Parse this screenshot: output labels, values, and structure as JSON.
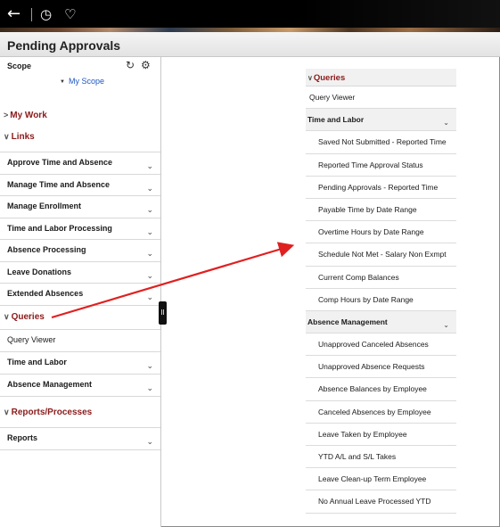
{
  "topbar": {
    "back_icon": "arrow-left-icon",
    "history_icon": "clock-icon",
    "favorites_icon": "heart-icon"
  },
  "page": {
    "title": "Pending Approvals"
  },
  "sidebar": {
    "scope": {
      "label": "Scope",
      "link": "My Scope",
      "refresh_icon": "refresh-icon",
      "settings_icon": "gear-icon"
    },
    "sections": {
      "my_work": "My Work",
      "links": "Links",
      "queries": "Queries",
      "reports": "Reports/Processes"
    },
    "links": [
      {
        "label": "Approve Time and Absence"
      },
      {
        "label": "Manage Time and Absence"
      },
      {
        "label": "Manage Enrollment"
      },
      {
        "label": "Time and Labor Processing"
      },
      {
        "label": "Absence Processing"
      },
      {
        "label": "Leave Donations"
      },
      {
        "label": "Extended Absences"
      }
    ],
    "queries": [
      {
        "label": "Query Viewer"
      },
      {
        "label": "Time and Labor"
      },
      {
        "label": "Absence Management"
      }
    ],
    "reports": [
      {
        "label": "Reports"
      }
    ]
  },
  "expanded_panel": {
    "header": "Queries",
    "query_viewer": "Query Viewer",
    "time_and_labor": {
      "label": "Time and Labor",
      "items": [
        "Saved Not Submitted - Reported Time",
        "Reported Time Approval Status",
        "Pending Approvals - Reported Time",
        "Payable Time by Date Range",
        "Overtime Hours by Date Range",
        "Schedule Not Met - Salary Non Exmpt",
        "Current Comp Balances",
        "Comp Hours by Date Range"
      ]
    },
    "absence_management": {
      "label": "Absence Management",
      "items": [
        "Unapproved Canceled Absences",
        "Unapproved Absence Requests",
        "Absence Balances by Employee",
        "Canceled Absences by Employee",
        "Leave Taken by Employee",
        "YTD A/L and S/L Takes",
        "Leave Clean-up Term Employee",
        "No Annual Leave Processed YTD"
      ]
    }
  },
  "colors": {
    "section_red": "#8b1a1a",
    "link_blue": "#1f57c4",
    "arrow_red": "#e02020"
  }
}
